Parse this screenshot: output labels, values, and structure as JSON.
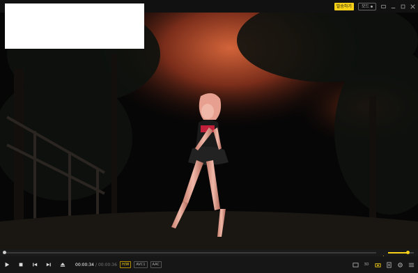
{
  "titlebar": {
    "badge_label": "발송하기",
    "mode_label": "모드",
    "accent_color": "#f7d117"
  },
  "controls": {
    "current_time": "00:00:34",
    "separator": "/",
    "total_time": "00:00:36",
    "hw_label": "H/W",
    "video_codec": "AVC1",
    "audio_codec": "AAC",
    "three_d_label": "3D"
  },
  "playback": {
    "progress_fraction": 0.0,
    "volume_fraction": 0.75
  }
}
